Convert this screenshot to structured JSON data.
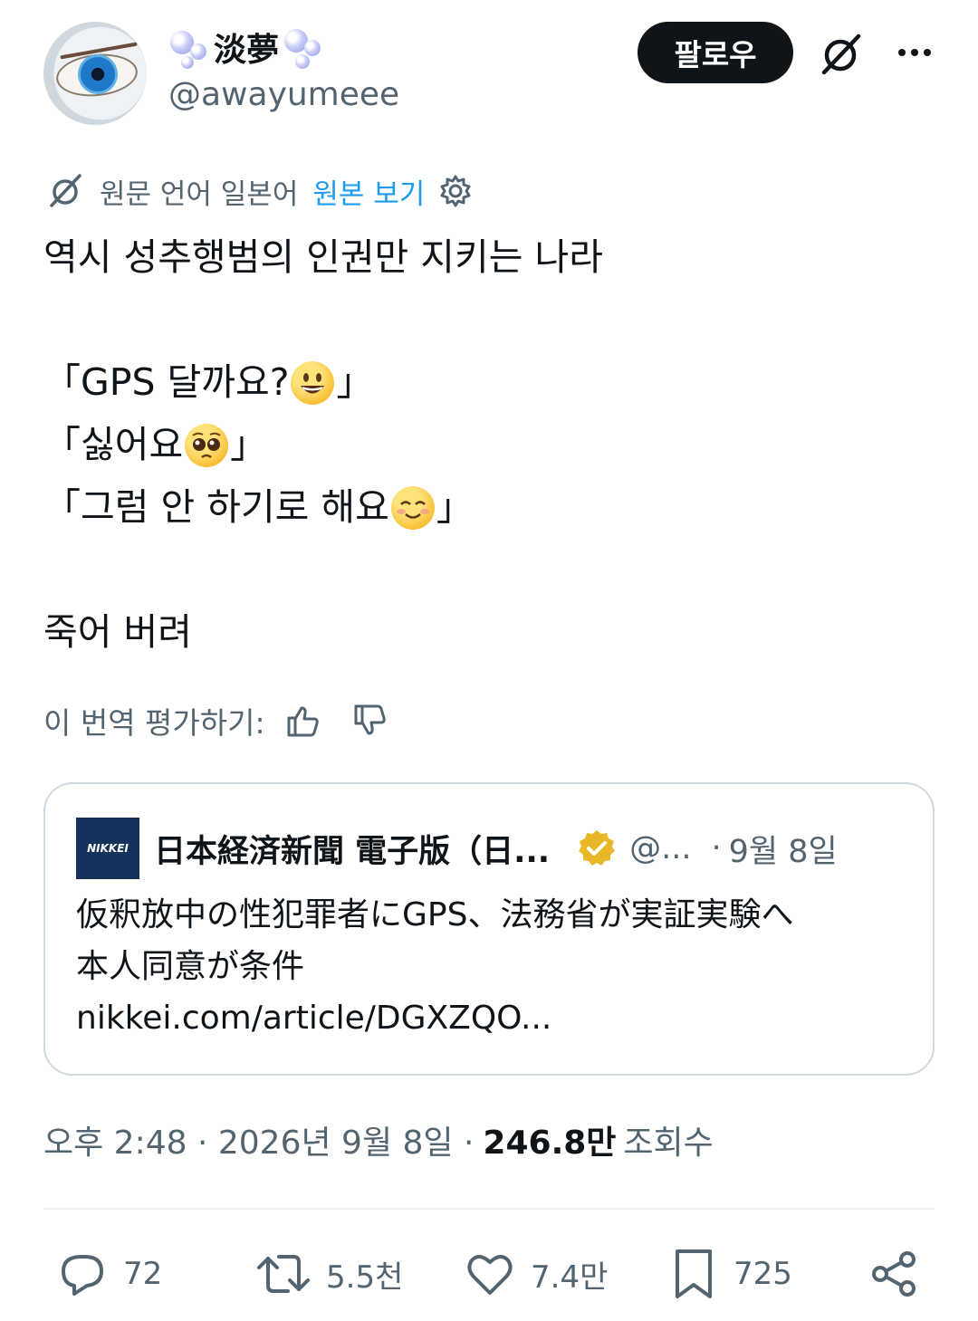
{
  "author": {
    "display_name": "淡夢",
    "handle": "@awayumeee",
    "avatar_icon": "eye-illustration-avatar"
  },
  "header": {
    "follow_label": "팔로우",
    "grok_icon": "grok-icon",
    "more_icon": "more-dots-icon"
  },
  "translation": {
    "source_label": "원문 언어 일본어",
    "view_original_label": "원본 보기",
    "link_color": "#1d9bf0"
  },
  "tweet": {
    "line1": "역시 성추행범의 인권만 지키는 나라",
    "line2_text": "「GPS 달까요?",
    "line2_close": "」",
    "line3_text": "「싫어요",
    "line3_close": "」",
    "line4_text": "「그럼 안 하기로 해요",
    "line4_close": "」",
    "line5": "죽어 버려",
    "emojis": [
      "grinning-face-emoji",
      "pleading-face-emoji",
      "smiling-face-emoji"
    ]
  },
  "rating": {
    "label": "이 번역 평가하기:"
  },
  "quote": {
    "logo_text": "NIKKEI",
    "name": "日本経済新聞 電子版（日...",
    "handle": "@...",
    "dot": "·",
    "date": "9월 8일",
    "body_line1": "仮釈放中の性犯罪者にGPS、法務省が実証実験へ",
    "body_line2": "本人同意が条件",
    "body_line3": "nikkei.com/article/DGXZQO...",
    "verified_color": "#e8b829"
  },
  "meta": {
    "time_date": "오후 2:48 · 2026년 9월 8일 ·",
    "views": "246.8만",
    "views_label": "조회수"
  },
  "actions": {
    "replies": "72",
    "reposts": "5.5천",
    "likes": "7.4만",
    "bookmarks": "725"
  }
}
